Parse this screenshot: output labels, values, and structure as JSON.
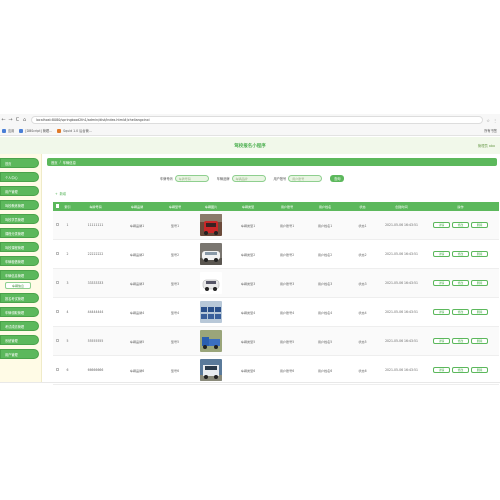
{
  "browser": {
    "back": "←",
    "forward": "→",
    "reload": "C",
    "home": "⌂",
    "url": "localhost:8080/springboot2th1/admin/dist/index.html#/cheliangxinxi",
    "nav_icons": [
      "☆",
      "⋮"
    ],
    "bookmarks": [
      {
        "icon": "app-icon",
        "label": "应用"
      },
      {
        "icon": "page-icon",
        "label": "[DBScript] 管理..."
      },
      {
        "icon": "page-icon",
        "label": "Squid 1.0 后台管..."
      }
    ],
    "bookmarks_right": "所有书签"
  },
  "header": {
    "title": "驾校报名小程序",
    "user": "管理员 abo"
  },
  "sidebar": {
    "items": [
      {
        "label": "首页"
      },
      {
        "label": "个人中心"
      },
      {
        "label": "用户管理"
      },
      {
        "label": "驾校教练管理"
      },
      {
        "label": "驾校学员管理"
      },
      {
        "label": "课程分类管理"
      },
      {
        "label": "驾校课程管理"
      },
      {
        "label": "车辆租借管理"
      },
      {
        "label": "车辆信息管理"
      }
    ],
    "active_sub": "车辆信息",
    "items_after": [
      {
        "label": "报名考试管理"
      },
      {
        "label": "车辆领取管理"
      },
      {
        "label": "考试成绩管理"
      },
      {
        "label": "系统管理"
      },
      {
        "label": "用户管理"
      }
    ]
  },
  "breadcrumb": {
    "home": "首页",
    "sep": "/",
    "current": "车辆信息"
  },
  "search": {
    "field1_label": "车牌号码",
    "field1_placeholder": "车牌号码",
    "field2_label": "车辆品牌",
    "field2_placeholder": "车辆品牌",
    "field3_label": "用户账号",
    "field3_placeholder": "用户账号",
    "button": "查询"
  },
  "toolbar": {
    "add_label": "新增"
  },
  "table": {
    "columns": [
      "",
      "索引",
      "车牌号码",
      "车辆品牌",
      "车辆型号",
      "车辆图片",
      "车辆类型",
      "用户账号",
      "用户姓名",
      "状态",
      "创建时间",
      "操作"
    ],
    "ops": [
      "详情",
      "修改",
      "删除"
    ],
    "rows": [
      {
        "idx": "1",
        "plate": "11111111",
        "brand": "车辆品牌1",
        "model": "型号1",
        "type": "车辆类型1",
        "acct": "用户账号1",
        "name": "用户姓名1",
        "status": "状态1",
        "time": "2021-05-06 16:43:51",
        "pic": "red"
      },
      {
        "idx": "2",
        "plate": "22222222",
        "brand": "车辆品牌2",
        "model": "型号2",
        "type": "车辆类型2",
        "acct": "用户账号2",
        "name": "用户姓名2",
        "status": "状态2",
        "time": "2021-05-06 16:43:51",
        "pic": "white-sedan"
      },
      {
        "idx": "3",
        "plate": "33333333",
        "brand": "车辆品牌3",
        "model": "型号3",
        "type": "车辆类型3",
        "acct": "用户账号3",
        "name": "用户姓名3",
        "status": "状态3",
        "time": "2021-05-06 16:43:51",
        "pic": "white-small"
      },
      {
        "idx": "4",
        "plate": "44444444",
        "brand": "车辆品牌4",
        "model": "型号4",
        "type": "车辆类型4",
        "acct": "用户账号4",
        "name": "用户姓名4",
        "status": "状态4",
        "time": "2021-05-06 16:43:51",
        "pic": "fleet"
      },
      {
        "idx": "5",
        "plate": "55555555",
        "brand": "车辆品牌5",
        "model": "型号5",
        "type": "车辆类型5",
        "acct": "用户账号5",
        "name": "用户姓名5",
        "status": "状态5",
        "time": "2021-05-06 16:43:51",
        "pic": "blue-truck"
      },
      {
        "idx": "6",
        "plate": "66666666",
        "brand": "车辆品牌6",
        "model": "型号6",
        "type": "车辆类型6",
        "acct": "用户账号6",
        "name": "用户姓名6",
        "status": "状态6",
        "time": "2021-05-06 16:43:51",
        "pic": "white-truck"
      }
    ]
  },
  "colors": {
    "accent": "#5cb85c",
    "header_bg": "#f1f8ea",
    "sidebar_bg": "#fffbe6"
  }
}
